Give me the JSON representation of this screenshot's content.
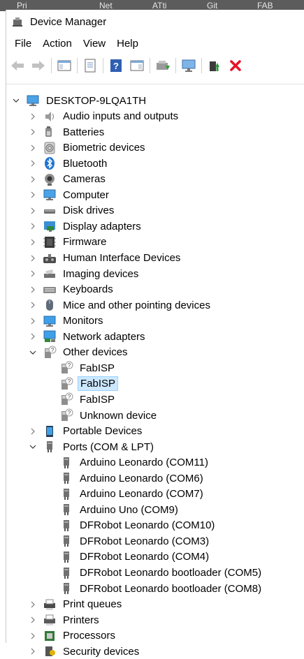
{
  "taskbar": [
    "Pri",
    "Net",
    "ATti",
    "Git",
    "FAB"
  ],
  "window": {
    "title": "Device Manager"
  },
  "menu": [
    "File",
    "Action",
    "View",
    "Help"
  ],
  "toolbar": [
    "back-icon",
    "forward-icon",
    "show-hide-console-tree-icon",
    "properties-icon",
    "help-icon",
    "action-pane-icon",
    "update-driver-icon",
    "scan-hardware-icon",
    "enable-device-icon",
    "uninstall-device-icon"
  ],
  "tree": {
    "root": "DESKTOP-9LQA1TH",
    "categories": [
      {
        "label": "Audio inputs and outputs",
        "icon": "speaker-icon",
        "expanded": false
      },
      {
        "label": "Batteries",
        "icon": "battery-icon",
        "expanded": false
      },
      {
        "label": "Biometric devices",
        "icon": "fingerprint-icon",
        "expanded": false
      },
      {
        "label": "Bluetooth",
        "icon": "bluetooth-icon",
        "expanded": false
      },
      {
        "label": "Cameras",
        "icon": "camera-icon",
        "expanded": false
      },
      {
        "label": "Computer",
        "icon": "computer-icon",
        "expanded": false
      },
      {
        "label": "Disk drives",
        "icon": "disk-drive-icon",
        "expanded": false
      },
      {
        "label": "Display adapters",
        "icon": "display-adapter-icon",
        "expanded": false
      },
      {
        "label": "Firmware",
        "icon": "firmware-chip-icon",
        "expanded": false
      },
      {
        "label": "Human Interface Devices",
        "icon": "hid-icon",
        "expanded": false
      },
      {
        "label": "Imaging devices",
        "icon": "scanner-icon",
        "expanded": false
      },
      {
        "label": "Keyboards",
        "icon": "keyboard-icon",
        "expanded": false
      },
      {
        "label": "Mice and other pointing devices",
        "icon": "mouse-icon",
        "expanded": false
      },
      {
        "label": "Monitors",
        "icon": "monitor-icon",
        "expanded": false
      },
      {
        "label": "Network adapters",
        "icon": "network-adapter-icon",
        "expanded": false
      },
      {
        "label": "Other devices",
        "icon": "unknown-device-icon",
        "expanded": true,
        "children": [
          {
            "label": "FabISP",
            "icon": "unknown-device-icon",
            "selected": false
          },
          {
            "label": "FabISP",
            "icon": "unknown-device-icon",
            "selected": true
          },
          {
            "label": "FabISP",
            "icon": "unknown-device-icon",
            "selected": false
          },
          {
            "label": "Unknown device",
            "icon": "unknown-device-icon",
            "selected": false
          }
        ]
      },
      {
        "label": "Portable Devices",
        "icon": "portable-device-icon",
        "expanded": false
      },
      {
        "label": "Ports (COM & LPT)",
        "icon": "port-icon",
        "expanded": true,
        "children": [
          {
            "label": "Arduino Leonardo (COM11)",
            "icon": "port-icon",
            "selected": false
          },
          {
            "label": "Arduino Leonardo (COM6)",
            "icon": "port-icon",
            "selected": false
          },
          {
            "label": "Arduino Leonardo (COM7)",
            "icon": "port-icon",
            "selected": false
          },
          {
            "label": "Arduino Uno (COM9)",
            "icon": "port-icon",
            "selected": false
          },
          {
            "label": "DFRobot Leonardo (COM10)",
            "icon": "port-icon",
            "selected": false
          },
          {
            "label": "DFRobot Leonardo (COM3)",
            "icon": "port-icon",
            "selected": false
          },
          {
            "label": "DFRobot Leonardo (COM4)",
            "icon": "port-icon",
            "selected": false
          },
          {
            "label": "DFRobot Leonardo bootloader (COM5)",
            "icon": "port-icon",
            "selected": false
          },
          {
            "label": "DFRobot Leonardo bootloader (COM8)",
            "icon": "port-icon",
            "selected": false
          }
        ]
      },
      {
        "label": "Print queues",
        "icon": "print-queue-icon",
        "expanded": false
      },
      {
        "label": "Printers",
        "icon": "printer-icon",
        "expanded": false
      },
      {
        "label": "Processors",
        "icon": "processor-icon",
        "expanded": false
      },
      {
        "label": "Security devices",
        "icon": "security-device-icon",
        "expanded": false
      }
    ]
  },
  "colors": {
    "selection": "#cce8ff",
    "selection_border": "#99d1ff",
    "uninstall": "#e81123",
    "accent": "#1e73d2"
  }
}
